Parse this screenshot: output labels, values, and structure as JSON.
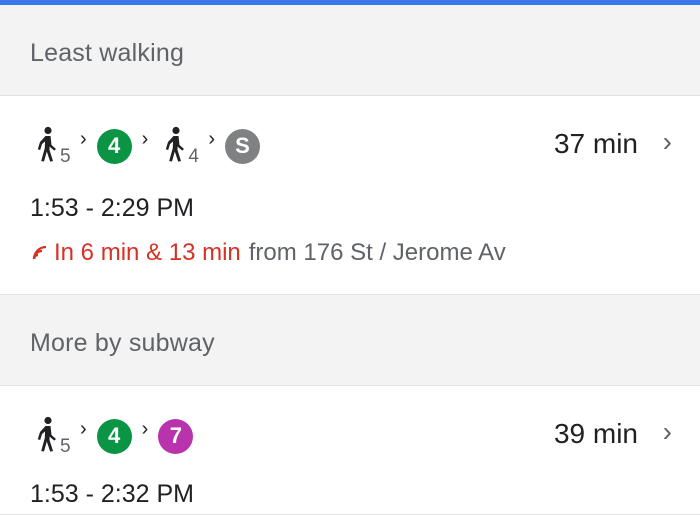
{
  "sections": {
    "least_walking": "Least walking",
    "more_by_subway": "More by subway"
  },
  "routes": [
    {
      "walk1": "5",
      "line1": {
        "label": "4",
        "color": "#0b9444"
      },
      "walk2": "4",
      "line2": {
        "label": "S",
        "color": "#808183"
      },
      "duration": "37 min",
      "times": "1:53 - 2:29 PM",
      "departures": "In 6 min & 13 min",
      "from": "from 176 St / Jerome Av"
    },
    {
      "walk1": "5",
      "line1": {
        "label": "4",
        "color": "#0b9444"
      },
      "line2": {
        "label": "7",
        "color": "#b933ad"
      },
      "duration": "39 min",
      "times": "1:53 - 2:32 PM"
    }
  ],
  "icons": {
    "walk": "walking-person-icon",
    "step_separator": "chevron-small-icon",
    "open": "chevron-right-icon",
    "realtime": "realtime-signal-icon"
  }
}
